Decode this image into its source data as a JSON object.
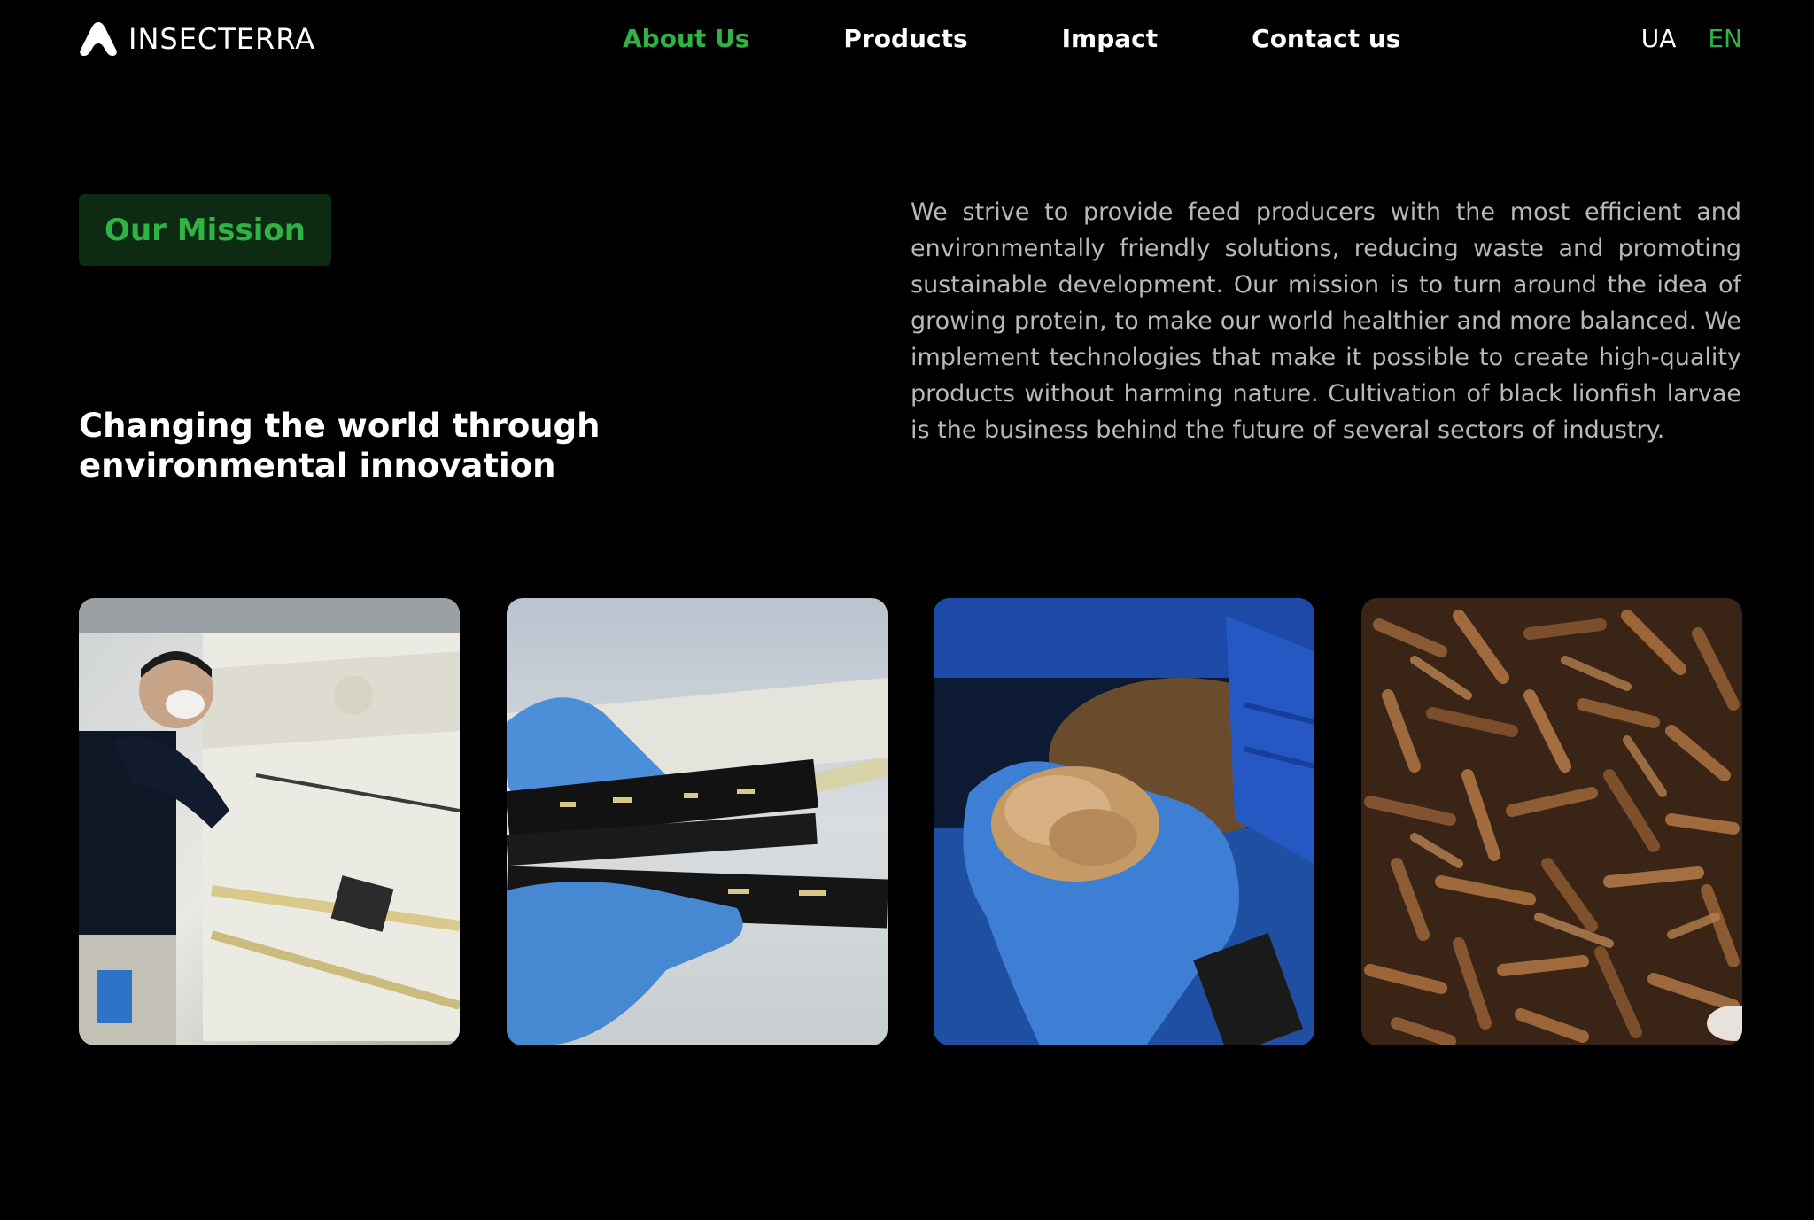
{
  "header": {
    "brand": "INSECTERRA",
    "nav": [
      {
        "label": "About Us",
        "active": true
      },
      {
        "label": "Products",
        "active": false
      },
      {
        "label": "Impact",
        "active": false
      },
      {
        "label": "Contact us",
        "active": false
      }
    ],
    "languages": [
      {
        "label": "UA",
        "active": false
      },
      {
        "label": "EN",
        "active": true
      }
    ]
  },
  "mission": {
    "badge": "Our Mission",
    "headline": "Changing the world through environmental innovation",
    "text": "We strive to provide feed producers with the most efficient and environmentally friendly solutions, reducing waste and promoting sustainable development. Our mission is to turn around the idea of growing protein, to make our world healthier and more balanced. We implement technologies that make it possible to create high-quality products without harming nature. Cultivation of black lionfish larvae is the business behind the future of several sectors of industry."
  },
  "colors": {
    "background": "#000000",
    "accent": "#2fb344",
    "badge_bg": "#0d2a12",
    "body_text": "#b8b8bc"
  }
}
